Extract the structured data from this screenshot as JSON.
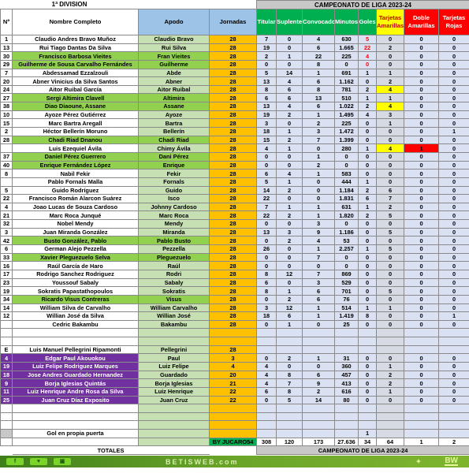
{
  "header": {
    "division": "1ª DIVISION",
    "competition": "CAMPEONATO  DE LIGA 2023-24",
    "columns": [
      "Nº",
      "Nombre Completo",
      "Apodo",
      "Jornadas",
      "Titular",
      "Suplente",
      "Convocado",
      "Minutos",
      "Goles",
      "Tarjetas Amarillas",
      "Doble Amarillas",
      "Tarjetas Rojas"
    ]
  },
  "colors": {
    "green": "#92d050",
    "purple": "#7030a0",
    "orange": "#ffc000",
    "yellow": "#ffff00",
    "red": "#ff0000",
    "stat_bg": "#d9e1f2"
  },
  "rows": [
    {
      "n": "1",
      "name": "Claudio Andres Bravo Muñoz",
      "apodo": "Claudio Bravo",
      "jor": "28",
      "s": [
        "7",
        "0",
        "4",
        "630",
        "5",
        "0",
        "0",
        "0"
      ],
      "style": "w",
      "gk": true
    },
    {
      "n": "13",
      "name": "Rui Tiago Dantas Da Silva",
      "apodo": "Rui Silva",
      "jor": "28",
      "s": [
        "19",
        "0",
        "6",
        "1.665",
        "22",
        "2",
        "0",
        "0"
      ],
      "style": "w",
      "gk": true
    },
    {
      "n": "30",
      "name": "Francisco Barbosa Vieites",
      "apodo": "Fran Vieites",
      "jor": "28",
      "s": [
        "2",
        "1",
        "22",
        "225",
        "4",
        "0",
        "0",
        "0"
      ],
      "style": "g",
      "gk": true
    },
    {
      "n": "29",
      "name": "Guilherme de Sousa Carvalho Fernándes",
      "apodo": "Guilherme",
      "jor": "28",
      "s": [
        "0",
        "0",
        "8",
        "0",
        "0",
        "0",
        "0",
        "0"
      ],
      "style": "g",
      "gk": true
    },
    {
      "n": "7",
      "name": "Abdessamad Ezzalzouli",
      "apodo": "Abde",
      "jor": "28",
      "s": [
        "5",
        "14",
        "1",
        "691",
        "1",
        "1",
        "0",
        "0"
      ],
      "style": "w"
    },
    {
      "n": "20",
      "name": "Abner Vinicius da Silva Santos",
      "apodo": "Abner",
      "jor": "28",
      "s": [
        "13",
        "4",
        "6",
        "1.162",
        "0",
        "2",
        "0",
        "0"
      ],
      "style": "w"
    },
    {
      "n": "24",
      "name": "Aitor Ruibal García",
      "apodo": "Aitor Ruibal",
      "jor": "28",
      "s": [
        "8",
        "6",
        "8",
        "781",
        "2",
        "4",
        "0",
        "0"
      ],
      "style": "w",
      "yellow": true
    },
    {
      "n": "27",
      "name": "Sergi Altimira Clavell",
      "apodo": "Altimira",
      "jor": "28",
      "s": [
        "6",
        "6",
        "13",
        "510",
        "1",
        "1",
        "0",
        "0"
      ],
      "style": "g"
    },
    {
      "n": "38",
      "name": "Diao Diaoune, Assane",
      "apodo": "Assane",
      "jor": "28",
      "s": [
        "13",
        "4",
        "6",
        "1.022",
        "2",
        "4",
        "0",
        "0"
      ],
      "style": "g",
      "yellow": true
    },
    {
      "n": "10",
      "name": "Ayoze Pérez Gutiérrez",
      "apodo": "Ayoze",
      "jor": "28",
      "s": [
        "19",
        "2",
        "1",
        "1.495",
        "4",
        "3",
        "0",
        "0"
      ],
      "style": "w"
    },
    {
      "n": "15",
      "name": "Marc Bartra Aregall",
      "apodo": "Bartra",
      "jor": "28",
      "s": [
        "3",
        "0",
        "2",
        "225",
        "0",
        "1",
        "0",
        "0"
      ],
      "style": "w"
    },
    {
      "n": "2",
      "name": "Héctor Bellerín Moruno",
      "apodo": "Bellerín",
      "jor": "28",
      "s": [
        "18",
        "1",
        "3",
        "1.472",
        "0",
        "0",
        "0",
        "1"
      ],
      "style": "w"
    },
    {
      "n": "28",
      "name": "Chadi Riad Dnanou",
      "apodo": "Chadi Riad",
      "jor": "28",
      "s": [
        "15",
        "2",
        "7",
        "1.399",
        "0",
        "0",
        "0",
        "0"
      ],
      "style": "g"
    },
    {
      "n": "",
      "name": "Luis Ezequiel Ávila",
      "apodo": "Chimy Ávila",
      "jor": "28",
      "s": [
        "4",
        "1",
        "0",
        "280",
        "1",
        "4",
        "1",
        "0"
      ],
      "style": "w",
      "yellow": true,
      "red": true
    },
    {
      "n": "37",
      "name": "Daniel Pérez Guerrero",
      "apodo": "Dani Pérez",
      "jor": "28",
      "s": [
        "0",
        "0",
        "1",
        "0",
        "0",
        "0",
        "0",
        "0"
      ],
      "style": "g"
    },
    {
      "n": "40",
      "name": "Enrique Fernández López",
      "apodo": "Enrique",
      "jor": "28",
      "s": [
        "0",
        "0",
        "2",
        "0",
        "0",
        "0",
        "0",
        "0"
      ],
      "style": "g"
    },
    {
      "n": "8",
      "name": "Nabil Fekir",
      "apodo": "Fekir",
      "jor": "28",
      "s": [
        "6",
        "4",
        "1",
        "583",
        "0",
        "0",
        "0",
        "0"
      ],
      "style": "w"
    },
    {
      "n": "",
      "name": "Pablo Fornals Malla",
      "apodo": "Fornals",
      "jor": "28",
      "s": [
        "5",
        "1",
        "0",
        "444",
        "1",
        "0",
        "0",
        "0"
      ],
      "style": "w"
    },
    {
      "n": "5",
      "name": "Guido Rodríguez",
      "apodo": "Guido",
      "jor": "28",
      "s": [
        "14",
        "2",
        "0",
        "1.184",
        "2",
        "6",
        "0",
        "0"
      ],
      "style": "w"
    },
    {
      "n": "22",
      "name": "Francisco Román Alarcon Suárez",
      "apodo": "Isco",
      "jor": "28",
      "s": [
        "22",
        "0",
        "0",
        "1.831",
        "6",
        "7",
        "0",
        "0"
      ],
      "style": "w"
    },
    {
      "n": "4",
      "name": "Joao Lucas de Souza Cardoso",
      "apodo": "Johnny Cardoso",
      "jor": "28",
      "s": [
        "7",
        "1",
        "1",
        "631",
        "1",
        "2",
        "0",
        "0"
      ],
      "style": "w"
    },
    {
      "n": "21",
      "name": "Marc Roca Junqué",
      "apodo": "Marc Roca",
      "jor": "28",
      "s": [
        "22",
        "2",
        "1",
        "1.820",
        "2",
        "5",
        "0",
        "0"
      ],
      "style": "w"
    },
    {
      "n": "32",
      "name": "Nobel Mendy",
      "apodo": "Mendy",
      "jor": "28",
      "s": [
        "0",
        "0",
        "3",
        "0",
        "0",
        "0",
        "0",
        "0"
      ],
      "style": "w"
    },
    {
      "n": "3",
      "name": "Juan Miranda González",
      "apodo": "Miranda",
      "jor": "28",
      "s": [
        "13",
        "3",
        "9",
        "1.186",
        "0",
        "5",
        "0",
        "0"
      ],
      "style": "w"
    },
    {
      "n": "42",
      "name": "Busto González, Pablo",
      "apodo": "Pablo Busto",
      "jor": "28",
      "s": [
        "0",
        "2",
        "4",
        "53",
        "0",
        "0",
        "0",
        "0"
      ],
      "style": "g"
    },
    {
      "n": "6",
      "name": "German Alejo Pezzella",
      "apodo": "Pezzella",
      "jor": "28",
      "s": [
        "26",
        "0",
        "1",
        "2.257",
        "1",
        "5",
        "0",
        "0"
      ],
      "style": "w"
    },
    {
      "n": "33",
      "name": "Xavier Pleguezuelo Selva",
      "apodo": "Pleguezuelo",
      "jor": "28",
      "s": [
        "0",
        "0",
        "7",
        "0",
        "0",
        "0",
        "0",
        "0"
      ],
      "style": "g"
    },
    {
      "n": "16",
      "name": "Raúl García de Haro",
      "apodo": "Raúl",
      "jor": "28",
      "s": [
        "0",
        "0",
        "0",
        "0",
        "0",
        "0",
        "0",
        "0"
      ],
      "style": "w"
    },
    {
      "n": "17",
      "name": "Rodrigo Sanchez Rodriguez",
      "apodo": "Rodri",
      "jor": "28",
      "s": [
        "8",
        "12",
        "7",
        "869",
        "0",
        "0",
        "0",
        "0"
      ],
      "style": "w"
    },
    {
      "n": "23",
      "name": "Youssouf Sabaly",
      "apodo": "Sabaly",
      "jor": "28",
      "s": [
        "6",
        "0",
        "3",
        "529",
        "0",
        "0",
        "0",
        "0"
      ],
      "style": "w"
    },
    {
      "n": "19",
      "name": "Sokratis Papastathopoulos",
      "apodo": "Sokratis",
      "jor": "28",
      "s": [
        "8",
        "1",
        "6",
        "701",
        "0",
        "5",
        "0",
        "0"
      ],
      "style": "w"
    },
    {
      "n": "34",
      "name": "Ricardo Visus Contreras",
      "apodo": "Visus",
      "jor": "28",
      "s": [
        "0",
        "2",
        "6",
        "76",
        "0",
        "0",
        "0",
        "0"
      ],
      "style": "g"
    },
    {
      "n": "14",
      "name": "William Silva de Carvalho",
      "apodo": "William Carvalho",
      "jor": "28",
      "s": [
        "3",
        "12",
        "1",
        "514",
        "1",
        "1",
        "0",
        "0"
      ],
      "style": "w"
    },
    {
      "n": "12",
      "name": "Willian José da Silva",
      "apodo": "Willian José",
      "jor": "28",
      "s": [
        "18",
        "6",
        "1",
        "1.419",
        "8",
        "0",
        "0",
        "1"
      ],
      "style": "w"
    },
    {
      "n": "",
      "name": "Cedric Bakambu",
      "apodo": "Bakambu",
      "jor": "28",
      "s": [
        "0",
        "1",
        "0",
        "25",
        "0",
        "0",
        "0",
        "0"
      ],
      "style": "w"
    },
    {
      "empty": true
    },
    {
      "empty": true
    },
    {
      "n": "E",
      "name": "Luis Manuel Pellegrini Ripamonti",
      "apodo": "Pellegrini",
      "jor": "28",
      "s": [
        "",
        "",
        "",
        "",
        "",
        "",
        "",
        ""
      ],
      "style": "w"
    },
    {
      "n": "4",
      "name": "Edgar Paul Akouokou",
      "apodo": "Paul",
      "jor": "3",
      "s": [
        "0",
        "2",
        "1",
        "31",
        "0",
        "0",
        "0",
        "0"
      ],
      "style": "p"
    },
    {
      "n": "19",
      "name": "Luiz Felipe Rodriguez Marques",
      "apodo": "Luiz Felipe",
      "jor": "4",
      "s": [
        "4",
        "0",
        "0",
        "360",
        "0",
        "1",
        "0",
        "0"
      ],
      "style": "p"
    },
    {
      "n": "18",
      "name": "Jose Andres Guardado Hernandez",
      "apodo": "Guardado",
      "jor": "20",
      "s": [
        "4",
        "8",
        "6",
        "457",
        "0",
        "2",
        "0",
        "0"
      ],
      "style": "p"
    },
    {
      "n": "9",
      "name": "Borja Iglesias Quintás",
      "apodo": "Borja Iglesias",
      "jor": "21",
      "s": [
        "4",
        "7",
        "9",
        "413",
        "0",
        "2",
        "0",
        "0"
      ],
      "style": "p"
    },
    {
      "n": "11",
      "name": "Luiz Henrique Andre Rosa da Silva",
      "apodo": "Luiz Henrique",
      "jor": "22",
      "s": [
        "6",
        "8",
        "2",
        "616",
        "0",
        "1",
        "0",
        "0"
      ],
      "style": "p"
    },
    {
      "n": "25",
      "name": "Juan Cruz Díaz Exposito",
      "apodo": "Juan Cruz",
      "jor": "22",
      "s": [
        "0",
        "5",
        "14",
        "80",
        "0",
        "0",
        "0",
        "0"
      ],
      "style": "p"
    },
    {
      "empty": true
    },
    {
      "empty": true
    },
    {
      "empty": true
    },
    {
      "n": "",
      "name": "Gol en propia puerta",
      "apodo": "",
      "jor": "",
      "s": [
        "",
        "",
        "",
        "",
        "1",
        "",
        "",
        ""
      ],
      "style": "og"
    }
  ],
  "totals": {
    "credit": "BY JUCARO54",
    "values": [
      "308",
      "120",
      "173",
      "27.636",
      "34",
      "64",
      "1",
      "2"
    ],
    "label": "TOTALES",
    "competition": "CAMPEONATO  DE LIGA 2023-24"
  },
  "footer": {
    "brand": "BETISWEB.com",
    "logo": "BW",
    "social": [
      "facebook-icon",
      "twitter-icon",
      "instagram-icon"
    ]
  }
}
